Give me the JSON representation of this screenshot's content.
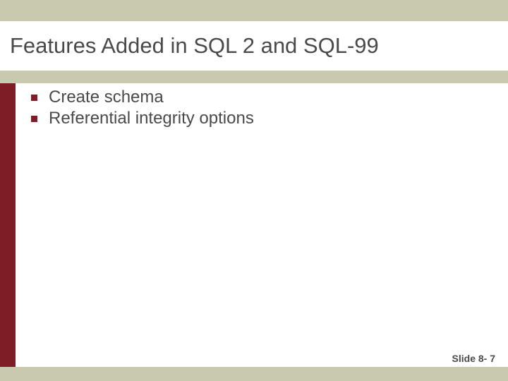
{
  "slide": {
    "title": "Features Added in SQL 2 and SQL-99",
    "bullets": [
      "Create schema",
      "Referential integrity options"
    ],
    "footer": "Slide 8- 7"
  },
  "colors": {
    "accent": "#7e1d26",
    "band": "#c9c9b0",
    "text": "#4a4a4a"
  }
}
